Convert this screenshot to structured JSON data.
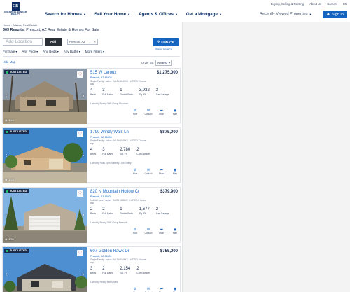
{
  "utility_nav": [
    "Buying, Selling & Renting",
    "About Us",
    "Careers",
    "EN"
  ],
  "brand": {
    "mark": "CB",
    "lines": [
      "COLDWELL BANKER",
      "REALTY"
    ]
  },
  "main_nav": [
    "Search for Homes",
    "Sell Your Home",
    "Agents & Offices",
    "Get a Mortgage"
  ],
  "recently_viewed": "Recently Viewed Properties",
  "sign_in": "Sign In",
  "breadcrumb": "Home › Arizona Real Estate",
  "results": {
    "count": "363 Results:",
    "text": "Prescott, AZ Real Estate & Homes For Sale"
  },
  "search": {
    "placeholder": "Add Location",
    "add_label": "Add",
    "chip": "Prescott, AZ",
    "chip_close": "×"
  },
  "update_label": "UPDATE",
  "save_search": "Save Search",
  "filters": [
    "For Sale",
    "Any Price",
    "Any Beds",
    "Any Baths",
    "More Filters"
  ],
  "hide_map": "Hide Map",
  "sort": {
    "label": "Order By:",
    "value": "Newest"
  },
  "listings": [
    {
      "badge": "JUST LISTED",
      "address": "515 W Leroux",
      "price": "$1,275,000",
      "city": "Prescott, AZ 86303",
      "meta": "Single Family · Active · MLS# 1045XX · LISTED 5 hours ago",
      "stats": [
        {
          "v": "4",
          "l": "Beds"
        },
        {
          "v": "3",
          "l": "Full Baths"
        },
        {
          "v": "1",
          "l": "Partial Bath"
        },
        {
          "v": "3,932",
          "l": "Sq. Ft."
        },
        {
          "v": "3",
          "l": "Car Garage"
        }
      ],
      "courtesy": "Listed by Realty ONE Group Mountain",
      "photos": "1/44"
    },
    {
      "badge": "JUST LISTED",
      "address": "1790 Windy Walk Ln",
      "price": "$875,000",
      "city": "Prescott, AZ 86305",
      "meta": "Single Family · Active · MLS# 1045XX · LISTED 7 hours ago",
      "stats": [
        {
          "v": "4",
          "l": "Beds"
        },
        {
          "v": "3",
          "l": "Full Baths"
        },
        {
          "v": "2,780",
          "l": "Sq. Ft."
        },
        {
          "v": "2",
          "l": "Car Garage"
        }
      ],
      "courtesy": "Listed by Russ Lyon Sotheby's Intl Realty",
      "photos": "1/25"
    },
    {
      "badge": "JUST LISTED",
      "address": "820 N Mountain Hollow Ct",
      "price": "$379,900",
      "city": "Prescott, AZ 86301",
      "meta": "Mobile Home · Active · MLS# 1045XX · LISTED 8 hours ago",
      "stats": [
        {
          "v": "2",
          "l": "Beds"
        },
        {
          "v": "2",
          "l": "Full Baths"
        },
        {
          "v": "1",
          "l": "Partial Bath"
        },
        {
          "v": "1,677",
          "l": "Sq. Ft."
        },
        {
          "v": "2",
          "l": "Car Garage"
        }
      ],
      "courtesy": "Listed by Realty ONE Group Prescott",
      "photos": "1/30"
    },
    {
      "badge": "JUST LISTED",
      "address": "607 Golden Hawk Dr",
      "price": "$755,000",
      "city": "Prescott, AZ 86301",
      "meta": "Single Family · Active · MLS# 1045XX · LISTED 9 hours ago",
      "stats": [
        {
          "v": "3",
          "l": "Beds"
        },
        {
          "v": "2",
          "l": "Full Baths"
        },
        {
          "v": "2,154",
          "l": "Sq. Ft."
        },
        {
          "v": "2",
          "l": "Car Garage"
        }
      ],
      "courtesy": "Listed by Realty Executives",
      "photos": "1/38"
    }
  ],
  "card_actions": [
    "Hide",
    "Contact",
    "Share",
    "Map"
  ],
  "colors": {
    "brand_navy": "#0b2d63",
    "accent_blue": "#1565c0",
    "favorite_red": "#c0262d"
  }
}
